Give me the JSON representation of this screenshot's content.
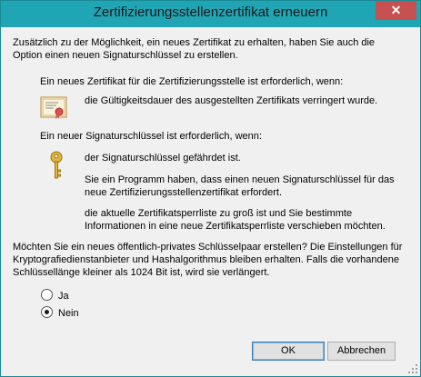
{
  "window": {
    "title": "Zertifizierungsstellenzertifikat erneuern",
    "close_glyph": "✕"
  },
  "content": {
    "intro": "Zusätzlich zu der Möglichkeit, ein neues Zertifikat zu erhalten, haben Sie auch die Option einen neuen Signaturschlüssel zu erstellen.",
    "cert_heading": "Ein neues Zertifikat für die Zertifizierungsstelle ist erforderlich, wenn:",
    "cert_reason": "die Gültigkeitsdauer des ausgestellten Zertifikats verringert wurde.",
    "key_heading": "Ein neuer Signaturschlüssel ist erforderlich, wenn:",
    "key_reasons": [
      "der Signaturschlüssel gefährdet ist.",
      "Sie ein Programm haben, dass einen neuen Signaturschlüssel für das neue Zertifizierungsstellenzertifikat erfordert.",
      "die aktuelle Zertifikatsperrliste zu groß ist und Sie bestimmte Informationen in eine neue Zertifikatsperrliste verschieben möchten."
    ],
    "question": "Möchten Sie ein neues öffentlich-privates Schlüsselpaar erstellen? Die Einstellungen für Kryptografiedienstanbieter und Hashalgorithmus bleiben erhalten. Falls die vorhandene Schlüssellänge kleiner als 1024 Bit ist, wird sie verlängert."
  },
  "options": [
    {
      "label": "Ja",
      "checked": false
    },
    {
      "label": "Nein",
      "checked": true
    }
  ],
  "buttons": {
    "ok": "OK",
    "cancel": "Abbrechen"
  },
  "icons": {
    "certificate": "certificate-icon",
    "key": "key-icon"
  }
}
